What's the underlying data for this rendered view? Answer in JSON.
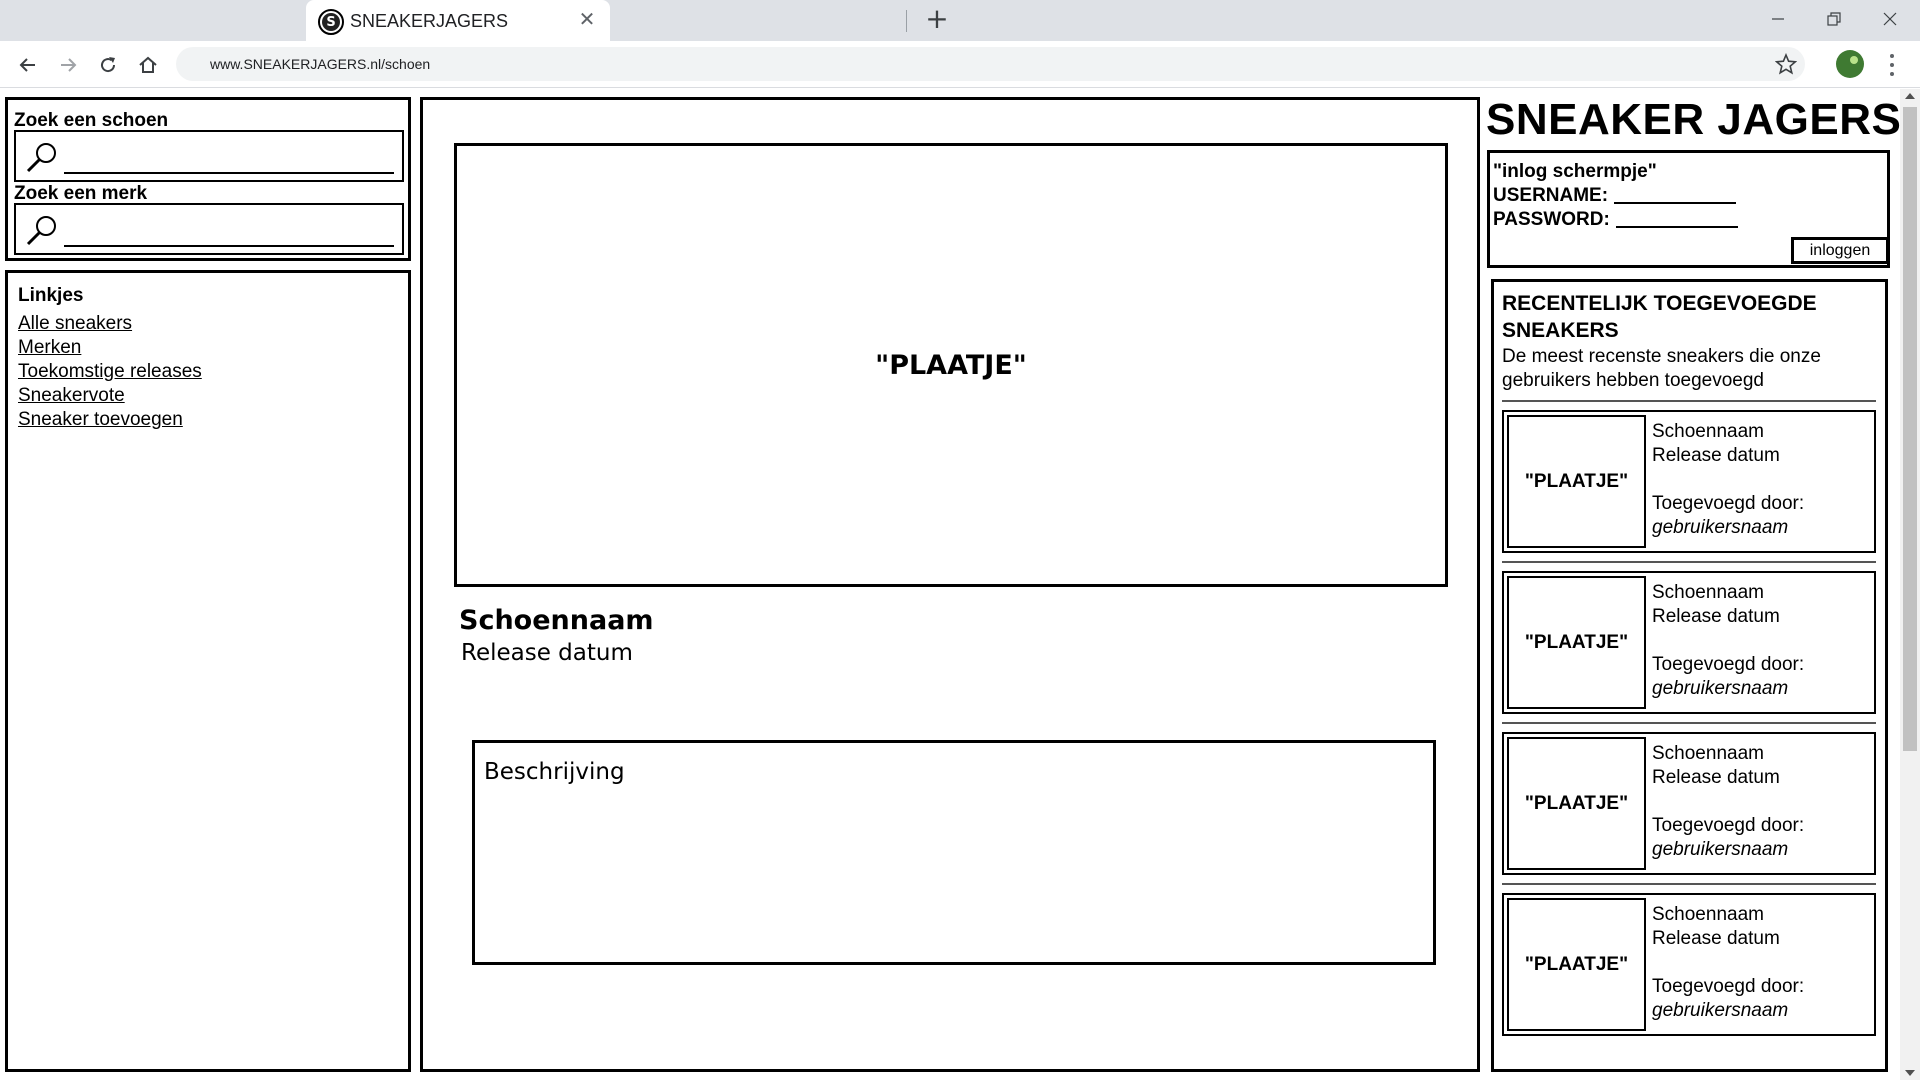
{
  "browser": {
    "tab_title": "SNEAKERJAGERS",
    "favicon_letter": "S",
    "url": "www.SNEAKERJAGERS.nl/schoen"
  },
  "sidebar": {
    "search_shoe_label": "Zoek een schoen",
    "search_brand_label": "Zoek een merk",
    "links_title": "Linkjes",
    "links": [
      "Alle sneakers",
      "Merken",
      "Toekomstige releases",
      "Sneakervote",
      "Sneaker toevoegen"
    ]
  },
  "main": {
    "image_placeholder": "\"PLAATJE\"",
    "shoe_name": "Schoennaam",
    "release_date": "Release datum",
    "description": "Beschrijving"
  },
  "site_title": "SNEAKER JAGERS",
  "login": {
    "title": "\"inlog schermpje\"",
    "username_label": "USERNAME:",
    "password_label": "PASSWORD:",
    "button_label": "inloggen"
  },
  "recent": {
    "title": "RECENTELIJK TOEGEVOEGDE SNEAKERS",
    "subtitle": "De meest recenste sneakers die onze gebruikers hebben toegevoegd",
    "cards": [
      {
        "image": "\"PLAATJE\"",
        "name": "Schoennaam",
        "release": "Release datum",
        "added_by": "Toegevoegd door:",
        "user": "gebruikersnaam"
      },
      {
        "image": "\"PLAATJE\"",
        "name": "Schoennaam",
        "release": "Release datum",
        "added_by": "Toegevoegd door:",
        "user": "gebruikersnaam"
      },
      {
        "image": "\"PLAATJE\"",
        "name": "Schoennaam",
        "release": "Release datum",
        "added_by": "Toegevoegd door:",
        "user": "gebruikersnaam"
      },
      {
        "image": "\"PLAATJE\"",
        "name": "Schoennaam",
        "release": "Release datum",
        "added_by": "Toegevoegd door:",
        "user": "gebruikersnaam"
      }
    ]
  },
  "icons": {
    "favicon": "sneakerjagers-favicon-icon",
    "tab_close": "close-icon",
    "new_tab": "plus-icon",
    "back": "arrow-left-icon",
    "forward": "arrow-right-icon",
    "reload": "reload-icon",
    "home": "home-icon",
    "bookmark": "star-icon",
    "extension": "frog-extension-icon",
    "menu": "kebab-menu-icon",
    "search": "magnifier-icon"
  }
}
